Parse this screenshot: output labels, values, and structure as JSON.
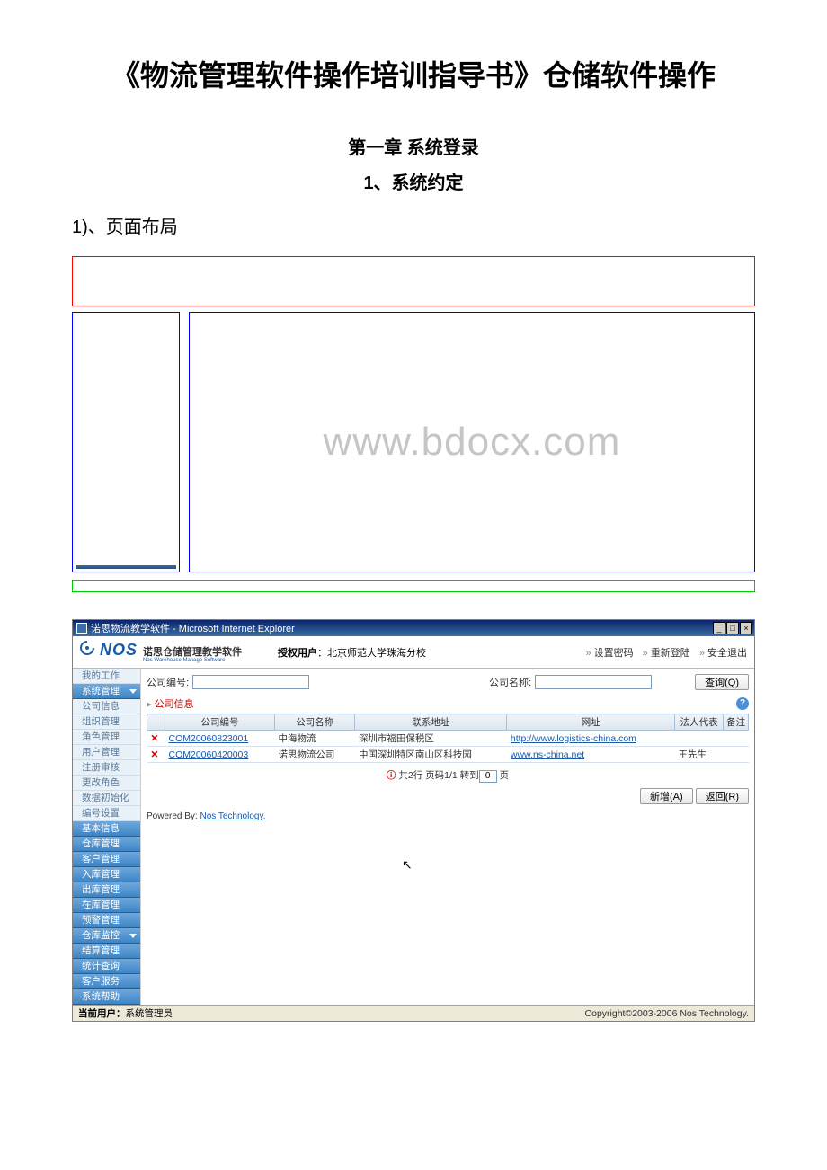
{
  "doc": {
    "title": "《物流管理软件操作培训指导书》仓储软件操作",
    "chapter": "第一章 系统登录",
    "section": "1、系统约定",
    "subsection": "1)、页面布局",
    "watermark": "www.bdocx.com"
  },
  "app": {
    "window_title": "诺思物流教学软件 - Microsoft Internet Explorer",
    "win_btns": {
      "min": "_",
      "max": "□",
      "close": "×"
    },
    "logo": {
      "main": "NOS",
      "sub": "诺思仓储管理教学软件",
      "sub_en": "Nos Warehouse Manage Software"
    },
    "auth_label": "授权用户",
    "auth_user": "：北京师范大学珠海分校",
    "top_links": [
      "设置密码",
      "重新登陆",
      "安全退出"
    ],
    "sidebar_top": [
      {
        "label": "我的工作",
        "light": true
      },
      {
        "label": "系统管理",
        "light": false
      }
    ],
    "sidebar_sub": [
      "公司信息",
      "组织管理",
      "角色管理",
      "用户管理",
      "注册审核",
      "更改角色",
      "数据初始化",
      "编号设置"
    ],
    "sidebar_bottom": [
      "基本信息",
      "仓库管理",
      "客户管理",
      "入库管理",
      "出库管理",
      "在库管理",
      "预警管理",
      "仓库监控",
      "结算管理",
      "统计查询",
      "客户服务",
      "系统帮助"
    ],
    "search": {
      "code_label": "公司编号:",
      "name_label": "公司名称:",
      "query_btn": "查询(Q)"
    },
    "crumb": "公司信息",
    "help": "?",
    "table": {
      "headers": [
        "公司编号",
        "公司名称",
        "联系地址",
        "网址",
        "法人代表",
        "备注"
      ],
      "rows": [
        {
          "code": "COM20060823001",
          "name": "中海物流",
          "addr": "深圳市福田保税区",
          "url": "http://www.logistics-china.com",
          "legal": "",
          "note": ""
        },
        {
          "code": "COM20060420003",
          "name": "诺思物流公司",
          "addr": "中国深圳特区南山区科技园",
          "url": "www.ns-china.net",
          "legal": "王先生",
          "note": ""
        }
      ]
    },
    "pager": {
      "total_prefix": "共",
      "total": "2",
      "row_word": "行",
      "page_word": "页码",
      "page_cur": "1",
      "sep": "/",
      "page_total": "1",
      "goto": "转到",
      "goto_val": "0",
      "page_suffix": "页"
    },
    "actions": {
      "add": "新增(A)",
      "back": "返回(R)"
    },
    "powered_label": "Powered By:",
    "powered_link": "Nos Technology.",
    "status": {
      "user_label": "当前用户：",
      "user": "系统管理员",
      "copyright": "Copyright©2003-2006 Nos Technology."
    }
  }
}
